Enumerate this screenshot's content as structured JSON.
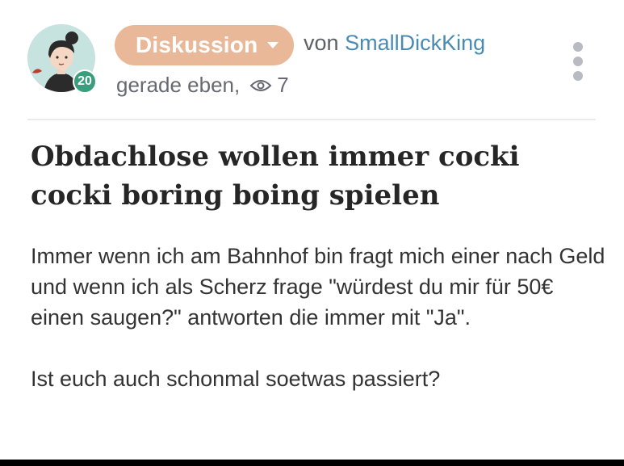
{
  "post": {
    "topic_label": "Diskussion",
    "by_prefix": "von",
    "author": "SmallDickKing",
    "time": "gerade eben,",
    "views": "7",
    "level": "20",
    "title": "Obdachlose wollen immer cocki cocki boring boing spielen",
    "body": [
      "Immer wenn ich am Bahnhof bin fragt mich einer nach Geld und wenn ich als Scherz frage \"würdest du mir für 50€ einen saugen?\" antworten die immer mit \"Ja\".",
      "Ist euch auch schonmal soetwas passiert?"
    ]
  },
  "icons": {
    "avatar": "girl-with-bun-illustration",
    "topic_dropdown": "caret-down-icon",
    "views": "eye-icon",
    "menu": "vertical-dots-icon"
  },
  "colors": {
    "topic_pill": "#e8b899",
    "author_link": "#4a8bb3",
    "level_badge": "#3a9d7c",
    "avatar_bg": "#c7e3df"
  }
}
